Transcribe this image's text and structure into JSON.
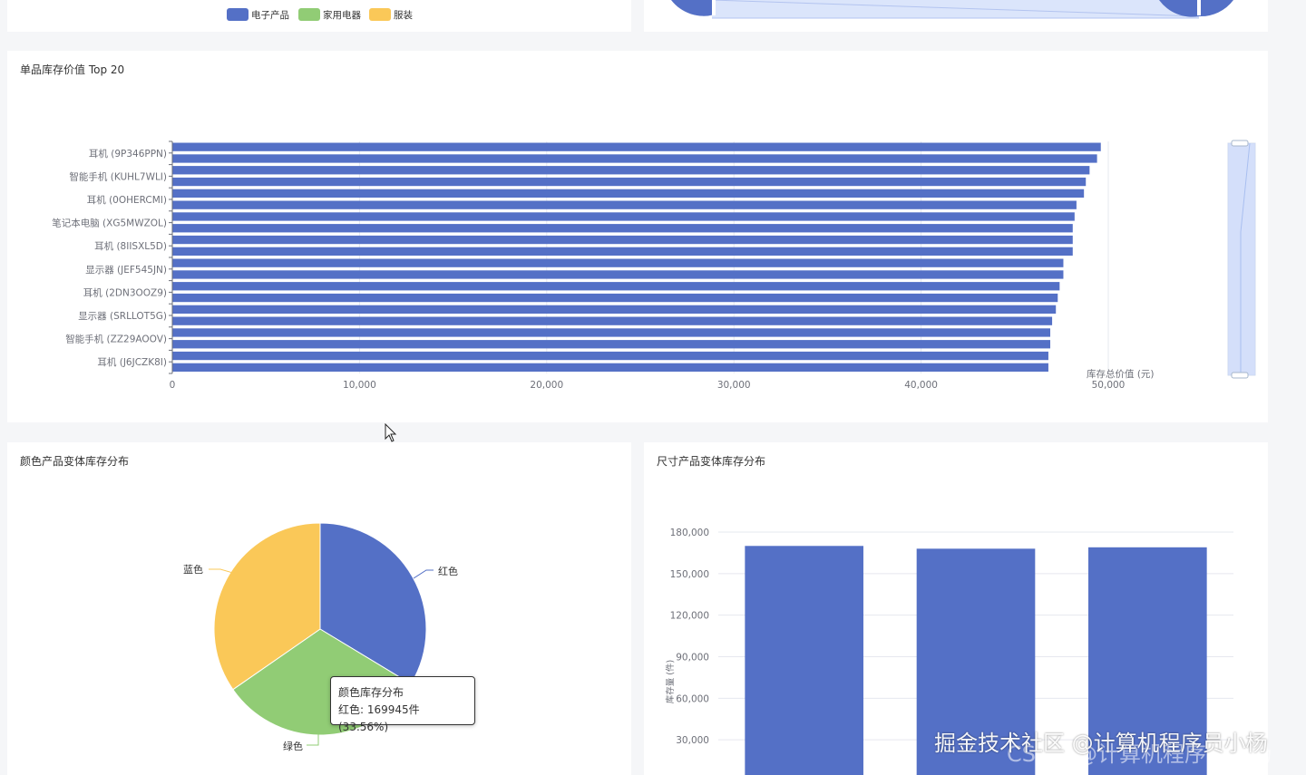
{
  "top_legend": [
    {
      "label": "电子产品",
      "color": "#5470c6"
    },
    {
      "label": "家用电器",
      "color": "#91cc75"
    },
    {
      "label": "服装",
      "color": "#fac858"
    }
  ],
  "colors": {
    "bar": "#5470c6",
    "red": "#5470c6",
    "green": "#91cc75",
    "blue": "#fac858",
    "track": "#d9e4fb"
  },
  "chart_data": [
    {
      "type": "bar",
      "orientation": "horizontal",
      "title": "单品库存价值 Top 20",
      "xlabel": "库存总价值 (元)",
      "xlim": [
        0,
        50000
      ],
      "x_ticks": [
        "0",
        "10,000",
        "20,000",
        "30,000",
        "40,000",
        "50,000"
      ],
      "y_tick_labels": [
        "耳机 (9P346PPN)",
        "智能手机 (KUHL7WLI)",
        "耳机 (0OHERCMI)",
        "笔记本电脑 (XG5MWZOL)",
        "耳机 (8IISXL5D)",
        "显示器 (JEF545JN)",
        "耳机 (2DN3OOZ9)",
        "显示器 (SRLLOT5G)",
        "智能手机 (ZZ29AOOV)",
        "耳机 (J6JCZK8I)"
      ],
      "values": [
        49600,
        49400,
        49000,
        48800,
        48700,
        48300,
        48200,
        48100,
        48100,
        48100,
        47600,
        47600,
        47400,
        47300,
        47200,
        47000,
        46900,
        46900,
        46800,
        46800
      ]
    },
    {
      "type": "pie",
      "title": "颜色产品变体库存分布",
      "labels": [
        "红色",
        "绿色",
        "蓝色"
      ],
      "values": [
        169945,
        160000,
        175000
      ]
    },
    {
      "type": "bar",
      "title": "尺寸产品变体库存分布",
      "ylabel": "库存量 (件)",
      "ylim": [
        0,
        180000
      ],
      "y_ticks": [
        "30,000",
        "60,000",
        "90,000",
        "120,000",
        "150,000",
        "180,000"
      ],
      "values": [
        170000,
        168000,
        169000
      ]
    }
  ],
  "tooltip": {
    "title": "颜色库存分布",
    "text": "红色: 169945件 (33.56%)"
  },
  "watermark": {
    "line1": "掘金技术社区 @计算机程序员小杨",
    "line2": "CSDN @计算机程序员小杨"
  }
}
